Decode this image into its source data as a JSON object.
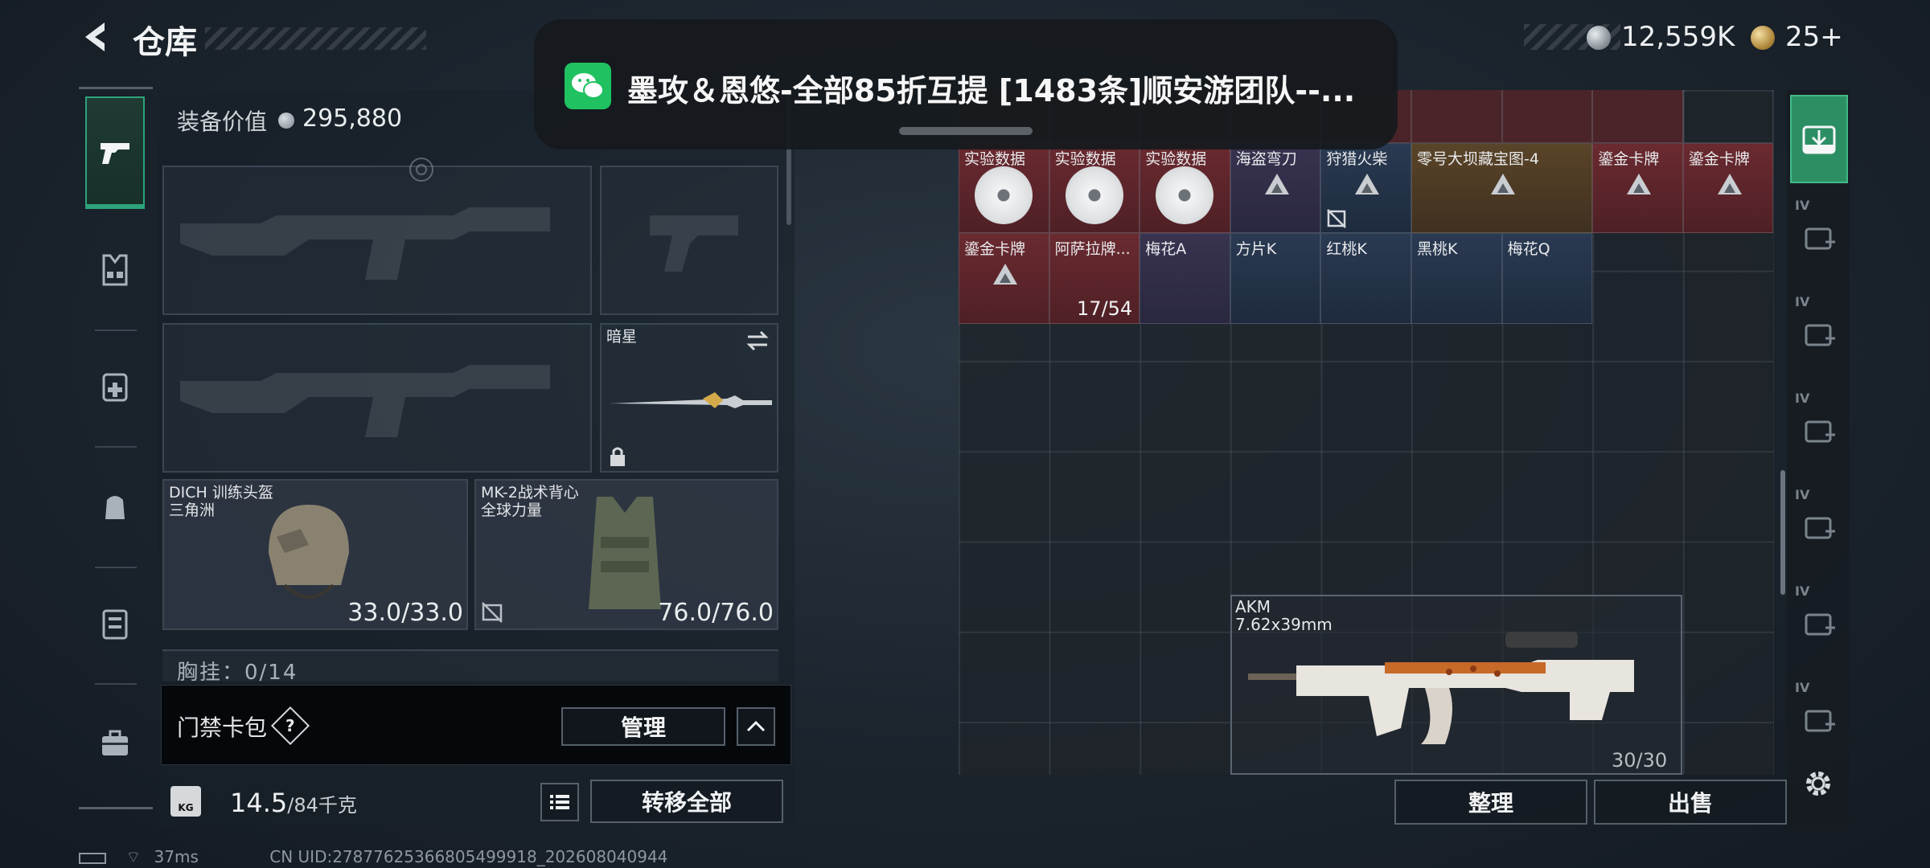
{
  "header": {
    "title": "仓库",
    "currency_main": "12,559K",
    "currency_premium": "25+"
  },
  "loadout": {
    "equipment_value_label": "装备价值",
    "equipment_value": "295,880",
    "melee_slot_label": "暗星",
    "helmet": {
      "name": "DICH 训练头盔",
      "faction": "三角洲",
      "durability": "33.0/33.0"
    },
    "vest": {
      "name": "MK-2战术背心",
      "faction": "全球力量",
      "durability": "76.0/76.0"
    },
    "chest_rig_label": "胸挂：0/14",
    "keycard_label": "门禁卡包",
    "help_glyph": "?",
    "manage_button": "管理",
    "weight_value": "14.5",
    "weight_capacity": "/84千克",
    "weight_icon_text": "KG",
    "transfer_all_button": "转移全部"
  },
  "status": {
    "ping": "37ms",
    "uid": "CN UID:2787762536680549991​8_202608040944"
  },
  "notification": {
    "app": "wechat-icon",
    "text": "墨攻＆恩悠-全部85折互提  [1483条]顺安游团队--..."
  },
  "storage": {
    "row1": [
      {
        "label": "实验数据",
        "kind": "disc",
        "rarity": "red"
      },
      {
        "label": "实验数据",
        "kind": "disc",
        "rarity": "red"
      },
      {
        "label": "实验数据",
        "kind": "disc",
        "rarity": "red"
      },
      {
        "label": "海盗弯刀",
        "kind": "tri",
        "rarity": "purple"
      },
      {
        "label": "狩猎火柴",
        "kind": "tri",
        "rarity": "blue"
      },
      {
        "label": "零号大坝藏宝图-4",
        "kind": "tri",
        "rarity": "gold"
      },
      {
        "label": "鎏金卡牌",
        "kind": "tri",
        "rarity": "red"
      },
      {
        "label": "鎏金卡牌",
        "kind": "tri",
        "rarity": "red"
      }
    ],
    "row2": [
      {
        "label": "鎏金卡牌",
        "kind": "tri",
        "rarity": "red"
      },
      {
        "label": "阿萨拉牌...",
        "kind": "none",
        "rarity": "red",
        "count": "17/54"
      },
      {
        "label": "梅花A",
        "kind": "none",
        "rarity": "purple"
      },
      {
        "label": "方片K",
        "kind": "none",
        "rarity": "blue"
      },
      {
        "label": "红桃K",
        "kind": "none",
        "rarity": "blue"
      },
      {
        "label": "黑桃K",
        "kind": "none",
        "rarity": "blue"
      },
      {
        "label": "梅花Q",
        "kind": "none",
        "rarity": "blue"
      }
    ],
    "weapon": {
      "name": "AKM",
      "caliber": "7.62x39mm",
      "ammo": "30/30"
    },
    "sort_button": "整理",
    "sell_button": "出售"
  },
  "right_rail": {
    "items": [
      "IV",
      "IV",
      "IV",
      "IV",
      "IV",
      "IV"
    ]
  },
  "colors": {
    "accent_green": "#2ea27a",
    "rarity_red": "#6a2a30",
    "rarity_gold": "#5a4428",
    "rarity_blue": "#2a3a52",
    "rarity_purple": "#383450"
  }
}
